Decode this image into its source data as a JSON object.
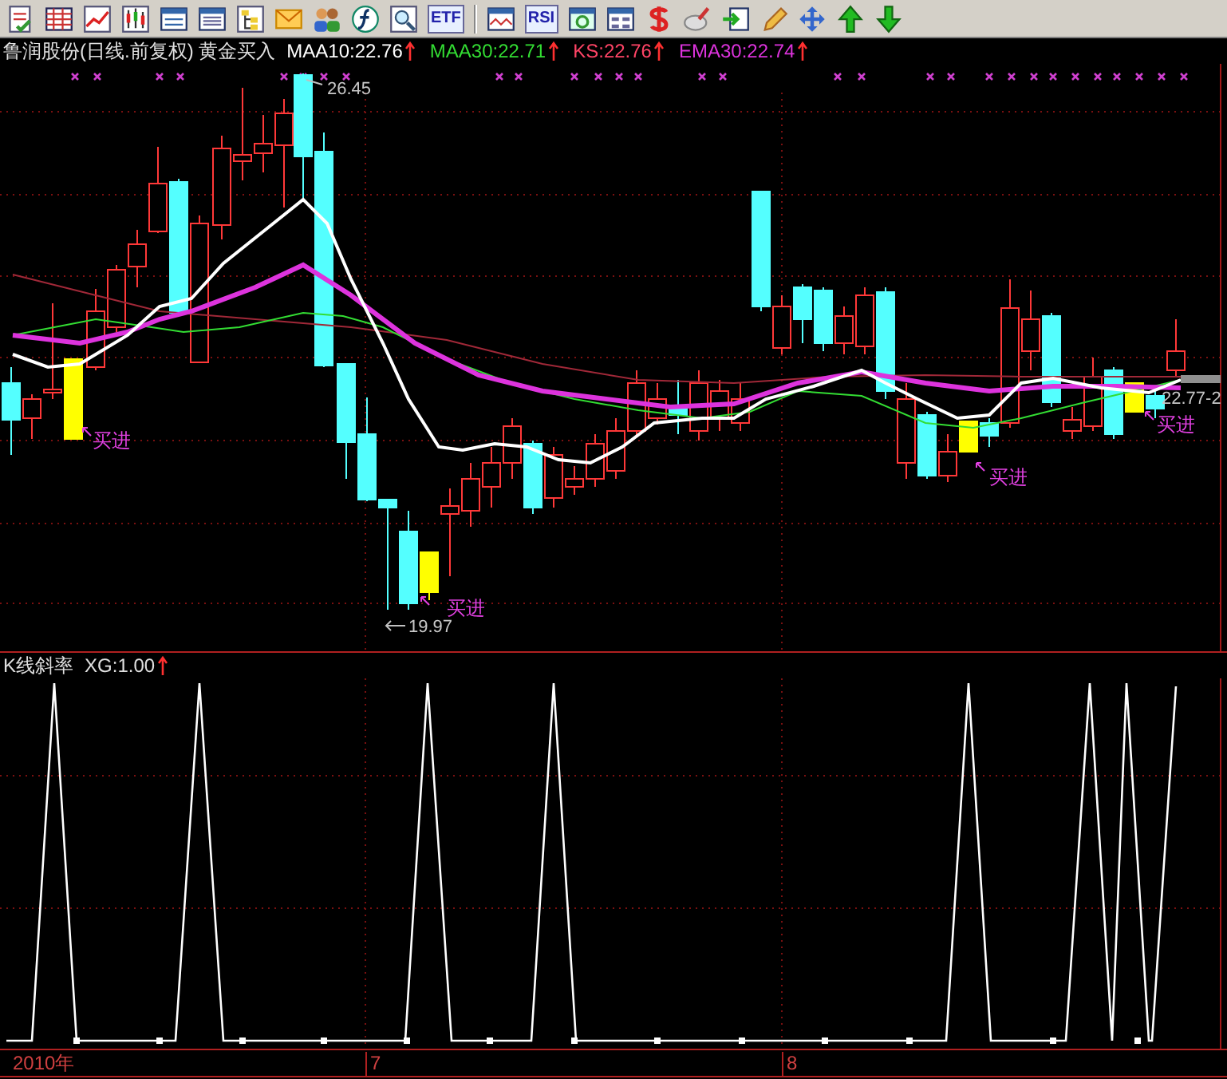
{
  "toolbar_labels": [
    "ETF",
    "RSI"
  ],
  "chart_header": {
    "title": "鲁润股份(日线.前复权) 黄金买入",
    "indicators": [
      {
        "text": "MAA10:22.76",
        "color": "#ffffff"
      },
      {
        "text": "MAA30:22.71",
        "color": "#33dd33"
      },
      {
        "text": "KS:22.76",
        "color": "#ff4466"
      },
      {
        "text": "EMA30:22.74",
        "color": "#dd33dd"
      }
    ]
  },
  "price_labels": [
    {
      "kind": "high",
      "text": "26.45"
    },
    {
      "kind": "low",
      "text": "19.97"
    },
    {
      "kind": "last",
      "text": "22.77-2"
    }
  ],
  "signals": [
    {
      "label": "买进"
    },
    {
      "label": "买进"
    },
    {
      "label": "买进"
    },
    {
      "label": "买进"
    }
  ],
  "lower_panel": {
    "title": "K线斜率",
    "indicator": "XG:1.00"
  },
  "time_axis": [
    "2010年",
    "7",
    "8"
  ]
}
